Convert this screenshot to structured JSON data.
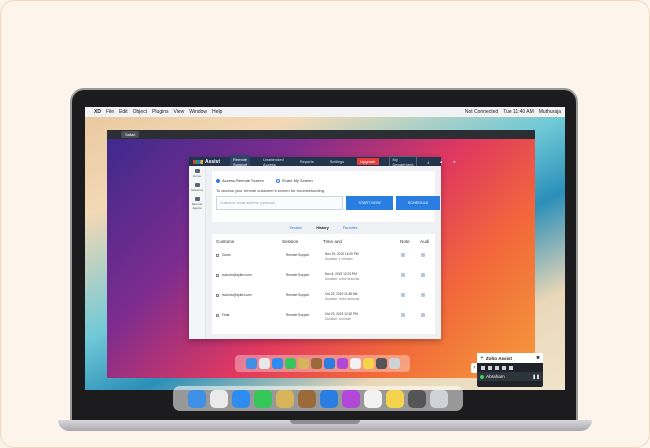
{
  "menubar": {
    "items": [
      "XD",
      "File",
      "Edit",
      "Object",
      "Plugins",
      "View",
      "Window",
      "Help"
    ],
    "status": "Not Connected",
    "clock": "Tue 11:40 AM",
    "user": "Muthuraja"
  },
  "remote_bar": {
    "items": [
      "Safari",
      "",
      "",
      "",
      "",
      "",
      ""
    ]
  },
  "app": {
    "brand": "Assist",
    "tabs": [
      "Remote Support",
      "Unattended Access",
      "Reports",
      "Settings"
    ],
    "upgrade": "Upgrade",
    "dept": "My Department",
    "side": [
      "Home",
      "Sessions",
      "Remote Agents"
    ],
    "mode_access": "Access Remote Screen",
    "mode_share": "Share My Screen",
    "hint": "To access your remote customer's screen for troubleshooting.",
    "email_placeholder": "Customer email address (optional)",
    "start": "START NOW",
    "schedule": "SCHEDULE",
    "list_tabs": [
      "Session",
      "History",
      "Favorites"
    ],
    "columns": {
      "customer": "Custome",
      "session": "Session",
      "time": "Time and",
      "note": "Note",
      "audit": "Audi"
    },
    "rows": [
      {
        "name": "Guest",
        "session": "Remote Support",
        "time": "Nov 29, 2019 14:00 PM",
        "dur": "Duration: 1 minutes"
      },
      {
        "name": "rsolomo@zylker.com",
        "session": "Remote Support",
        "time": "Nov 8, 2019 12:23 PM",
        "dur": "Duration: a few seconds"
      },
      {
        "name": "rsolomo@zylker.com",
        "session": "Remote Support",
        "time": "Oct 23, 2019 11:38 AM",
        "dur": "Duration: a few seconds"
      },
      {
        "name": "Frida",
        "session": "Remote Support",
        "time": "Oct 23, 2019 12:52 PM",
        "dur": "Duration: a minute"
      }
    ]
  },
  "widget": {
    "title": "Zoho Assist",
    "user": "Abraham",
    "close": "✖"
  },
  "colors": {
    "accent": "#2a7de1",
    "header": "#23344d"
  }
}
